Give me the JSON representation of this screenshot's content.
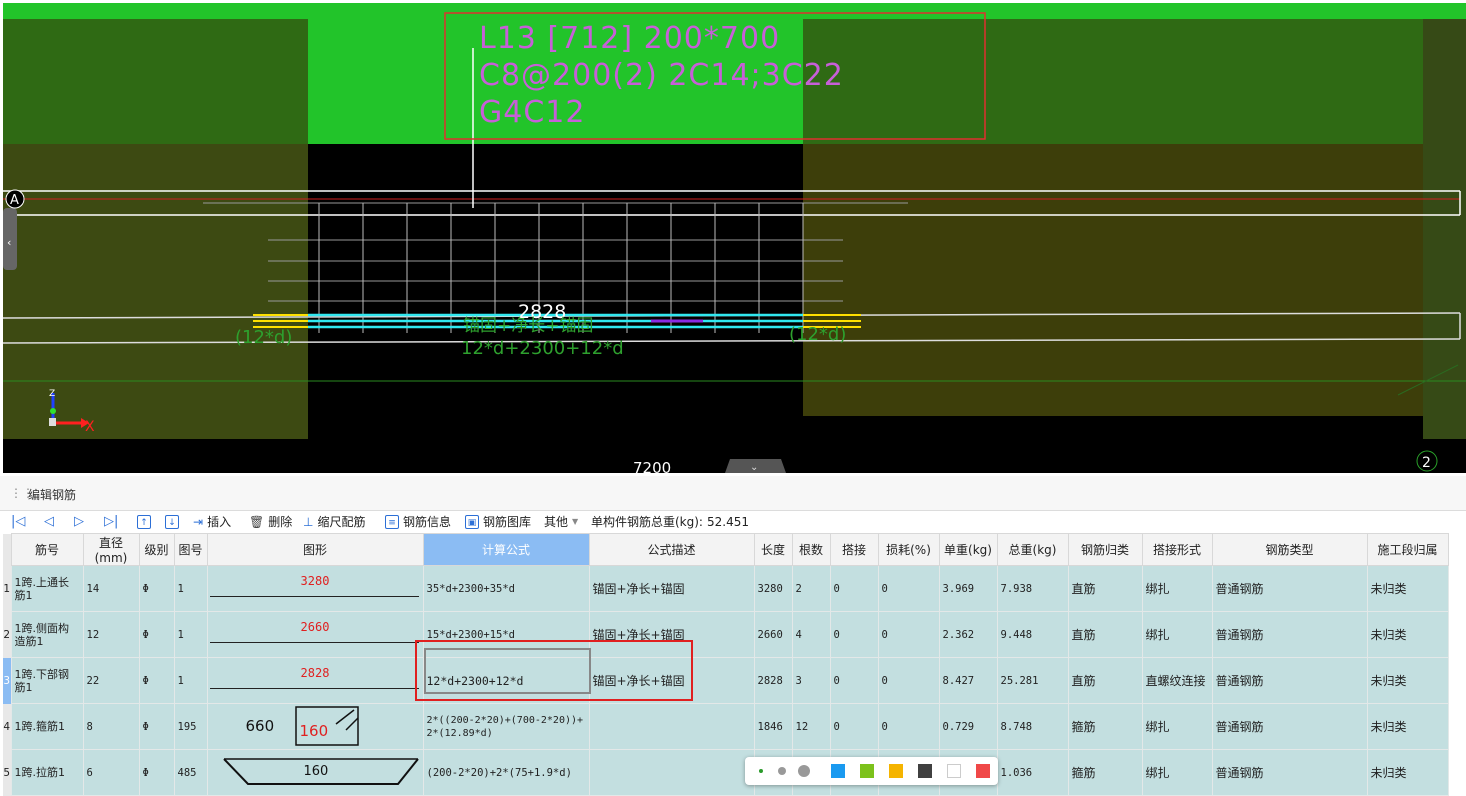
{
  "viewport": {
    "annotation_lines": [
      "L13 [712] 200*700",
      "C8@200(2) 2C14;3C22",
      "G4C12"
    ],
    "axis_label_A": "A",
    "axis_label_2": "2",
    "dim_value": "2828",
    "formula_desc": "锚固+净长+锚固",
    "formula": "12*d+2300+12*d",
    "left_anchor": "(12*d)",
    "right_anchor": "(12*d)",
    "bottom_dim": "7200",
    "axis_x": "X",
    "axis_z": "Z"
  },
  "panel": {
    "title": "编辑钢筋",
    "toolbar": {
      "insert": "插入",
      "delete": "删除",
      "scale": "缩尺配筋",
      "info": "钢筋信息",
      "library": "钢筋图库",
      "other": "其他",
      "total_label": "单构件钢筋总重(kg):",
      "total_value": "52.451"
    },
    "columns": [
      "筋号",
      "直径(mm)",
      "级别",
      "图号",
      "图形",
      "计算公式",
      "公式描述",
      "长度",
      "根数",
      "搭接",
      "损耗(%)",
      "单重(kg)",
      "总重(kg)",
      "钢筋归类",
      "搭接形式",
      "钢筋类型",
      "施工段归属"
    ],
    "rows": [
      {
        "no": "1",
        "name": "1跨.上通长筋1",
        "dia": "14",
        "grade": "Φ",
        "fig": "1",
        "shape_val": "3280",
        "formula": "35*d+2300+35*d",
        "desc": "锚固+净长+锚固",
        "len": "3280",
        "count": "2",
        "lap": "0",
        "loss": "0",
        "unit_w": "3.969",
        "total_w": "7.938",
        "category": "直筋",
        "lap_type": "绑扎",
        "type": "普通钢筋",
        "stage": "未归类"
      },
      {
        "no": "2",
        "name": "1跨.侧面构造筋1",
        "dia": "12",
        "grade": "Φ",
        "fig": "1",
        "shape_val": "2660",
        "formula": "15*d+2300+15*d",
        "desc": "锚固+净长+锚固",
        "len": "2660",
        "count": "4",
        "lap": "0",
        "loss": "0",
        "unit_w": "2.362",
        "total_w": "9.448",
        "category": "直筋",
        "lap_type": "绑扎",
        "type": "普通钢筋",
        "stage": "未归类"
      },
      {
        "no": "3",
        "name": "1跨.下部钢筋1",
        "dia": "22",
        "grade": "Φ",
        "fig": "1",
        "shape_val": "2828",
        "formula": "12*d+2300+12*d",
        "desc": "锚固+净长+锚固",
        "len": "2828",
        "count": "3",
        "lap": "0",
        "loss": "0",
        "unit_w": "8.427",
        "total_w": "25.281",
        "category": "直筋",
        "lap_type": "直螺纹连接",
        "type": "普通钢筋",
        "stage": "未归类"
      },
      {
        "no": "4",
        "name": "1跨.箍筋1",
        "dia": "8",
        "grade": "Φ",
        "fig": "195",
        "shape_a": "660",
        "shape_b": "160",
        "formula": "2*((200-2*20)+(700-2*20))+2*(12.89*d)",
        "desc": "",
        "len": "1846",
        "count": "12",
        "lap": "0",
        "loss": "0",
        "unit_w": "0.729",
        "total_w": "8.748",
        "category": "箍筋",
        "lap_type": "绑扎",
        "type": "普通钢筋",
        "stage": "未归类"
      },
      {
        "no": "5",
        "name": "1跨.拉筋1",
        "dia": "6",
        "grade": "Φ",
        "fig": "485",
        "shape_a": "160",
        "formula": "(200-2*20)+2*(75+1.9*d)",
        "desc": "",
        "len": "",
        "count": "",
        "lap": "",
        "loss": "",
        "unit_w": "",
        "total_w": "1.036",
        "category": "箍筋",
        "lap_type": "绑扎",
        "type": "普通钢筋",
        "stage": "未归类"
      }
    ]
  },
  "palette_colors": [
    "#1a9af0",
    "#7cc21c",
    "#f5b400",
    "#404040",
    "#ffffff",
    "#f04848"
  ]
}
